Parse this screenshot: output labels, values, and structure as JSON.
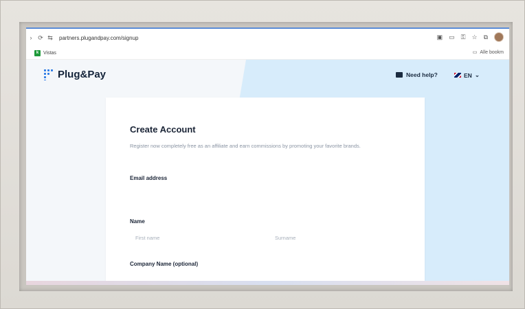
{
  "browser": {
    "url": "partners.plugandpay.com/signup",
    "bookmark_label": "Vistas",
    "bookmark_icon": "k",
    "all_bookmarks_label": "Alle bookm"
  },
  "header": {
    "brand": "Plug&Pay",
    "help_label": "Need help?",
    "language": "EN"
  },
  "form": {
    "title": "Create Account",
    "subtitle": "Register now completely free as an affiliate and earn commissions by promoting your favorite brands.",
    "email_label": "Email address",
    "name_label": "Name",
    "first_name_placeholder": "First name",
    "surname_placeholder": "Surname",
    "company_label": "Company Name (optional)"
  },
  "colors": {
    "brand_blue": "#2c7be5",
    "pane_blue": "#d7ecfb"
  }
}
